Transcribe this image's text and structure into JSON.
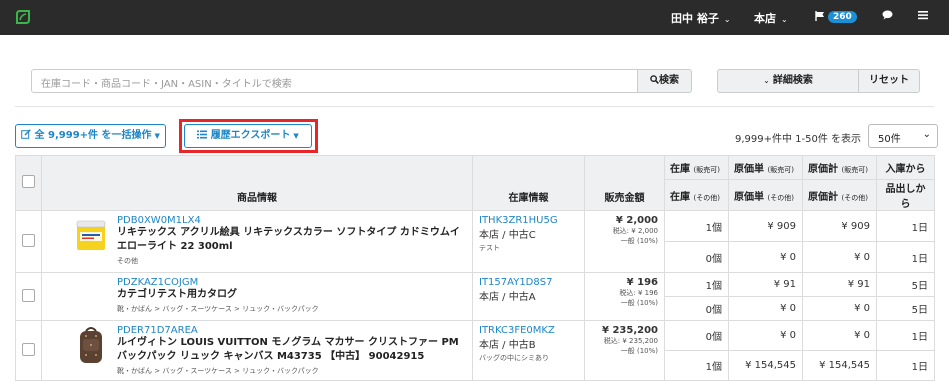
{
  "header": {
    "user": "田中 裕子",
    "store": "本店",
    "notifications": "260"
  },
  "search": {
    "placeholder": "在庫コード・商品コード・JAN・ASIN・タイトルで検索",
    "button": "検索",
    "detail": "詳細検索",
    "reset": "リセット"
  },
  "toolbar": {
    "bulk": "全 9,999+件 を一括操作",
    "export": "履歴エクスポート",
    "count": "9,999+件中 1-50件 を表示",
    "per_page": "50件"
  },
  "table": {
    "h_product": "商品情報",
    "h_stock_info": "在庫情報",
    "h_price": "販売金額",
    "h_stock": "在庫",
    "h_stock_sub1": "(販売可)",
    "h_stock_sub2": "(その他)",
    "h_cost_unit": "原価単",
    "h_cost_total": "原価計",
    "h_days1": "入庫から",
    "h_days2": "品出しから",
    "rows": [
      {
        "code": "PDB0XW0M1LX4",
        "name": "リキテックス アクリル絵具 リキテックスカラー ソフトタイプ カドミウムイエローライト 22 300ml",
        "category": "その他",
        "stock_code": "ITHK3ZR1HU5G",
        "location": "本店 / 中古C",
        "note": "テスト",
        "price": "¥ 2,000",
        "tax": "税込: ¥ 2,000",
        "tax_type": "一般 (10%)",
        "qty1": "1個",
        "qty2": "0個",
        "unit1": "¥ 909",
        "unit2": "¥ 0",
        "total1": "¥ 909",
        "total2": "¥ 0",
        "days1": "1日",
        "days2": "1日"
      },
      {
        "code": "PDZKAZ1COJGM",
        "name": "カテゴリテスト用カタログ",
        "category": "靴・かばん > バッグ・スーツケース > リュック・バックパック",
        "stock_code": "IT157AY1D8S7",
        "location": "本店 / 中古A",
        "note": "",
        "price": "¥ 196",
        "tax": "税込: ¥ 196",
        "tax_type": "一般 (10%)",
        "qty1": "1個",
        "qty2": "0個",
        "unit1": "¥ 91",
        "unit2": "¥ 0",
        "total1": "¥ 91",
        "total2": "¥ 0",
        "days1": "5日",
        "days2": "5日"
      },
      {
        "code": "PDER71D7AREA",
        "name": "ルイヴィトン LOUIS VUITTON モノグラム マカサー クリストファー PM バックパック リュック キャンバス M43735 【中古】 90042915",
        "category": "靴・かばん > バッグ・スーツケース > リュック・バックパック",
        "stock_code": "ITRKC3FE0MKZ",
        "location": "本店 / 中古B",
        "note": "バッグの中にシミあり",
        "price": "¥ 235,200",
        "tax": "税込: ¥ 235,200",
        "tax_type": "一般 (10%)",
        "qty1": "0個",
        "qty2": "1個",
        "unit1": "¥ 0",
        "unit2": "¥ 154,545",
        "total1": "¥ 0",
        "total2": "¥ 154,545",
        "days1": "1日",
        "days2": "1日"
      }
    ]
  }
}
